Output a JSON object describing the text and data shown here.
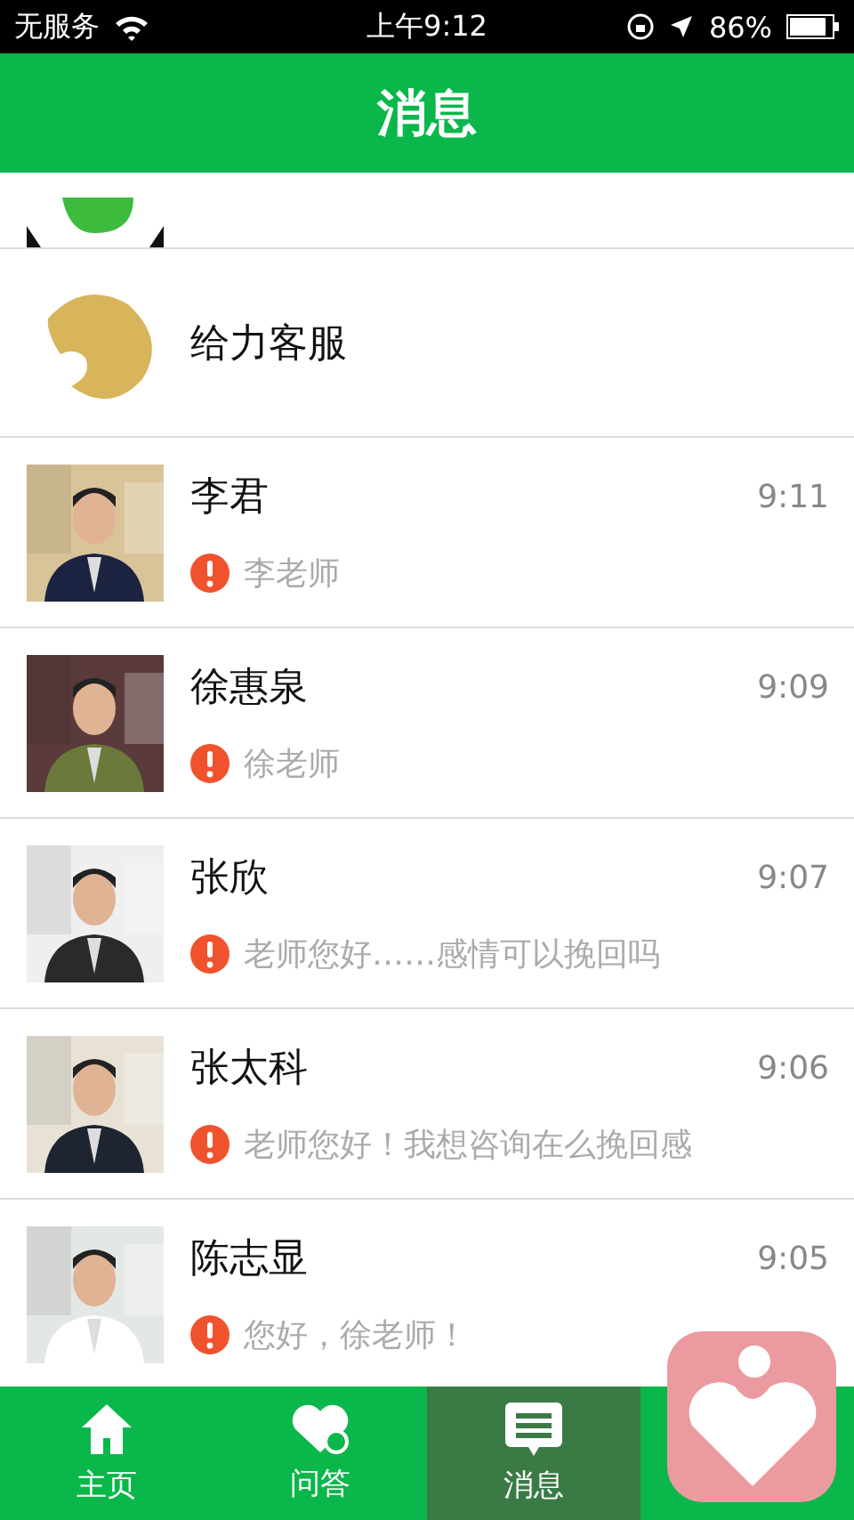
{
  "status_bar": {
    "carrier": "无服务",
    "time": "上午9:12",
    "battery": "86%"
  },
  "header": {
    "title": "消息"
  },
  "conversations": [
    {
      "kind": "partial"
    },
    {
      "kind": "service",
      "name": "给力客服"
    },
    {
      "kind": "chat",
      "name": "李君",
      "time": "9:11",
      "preview": "李老师",
      "alert": true
    },
    {
      "kind": "chat",
      "name": "徐惠泉",
      "time": "9:09",
      "preview": "徐老师",
      "alert": true
    },
    {
      "kind": "chat",
      "name": "张欣",
      "time": "9:07",
      "preview": "老师您好……感情可以挽回吗",
      "alert": true
    },
    {
      "kind": "chat",
      "name": "张太科",
      "time": "9:06",
      "preview": "老师您好！我想咨询在么挽回感",
      "alert": true
    },
    {
      "kind": "chat",
      "name": "陈志显",
      "time": "9:05",
      "preview": "您好，徐老师！",
      "alert": true
    }
  ],
  "tabs": [
    {
      "kind": "home",
      "label": "主页",
      "selected": false
    },
    {
      "kind": "qa",
      "label": "问答",
      "selected": false
    },
    {
      "kind": "messages",
      "label": "消息",
      "selected": true
    },
    {
      "kind": "hidden",
      "selected": false
    }
  ]
}
